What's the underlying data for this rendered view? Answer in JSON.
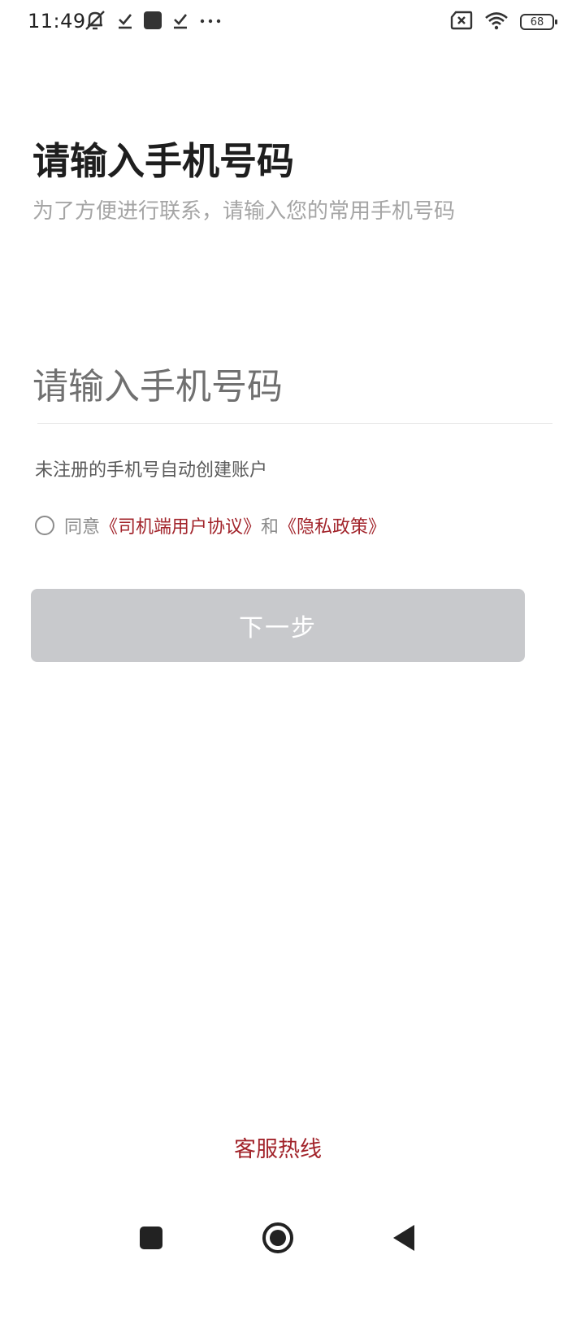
{
  "status_bar": {
    "time": "11:49",
    "battery_level": "68",
    "left_icons": [
      "bell-muted-icon",
      "download-done-icon",
      "app-square-icon",
      "download-done-icon",
      "more-dots-icon"
    ],
    "right_icons": [
      "no-sim-icon",
      "wifi-icon",
      "battery-icon"
    ]
  },
  "page": {
    "title": "请输入手机号码",
    "subtitle": "为了方便进行联系，请输入您的常用手机号码"
  },
  "phone_input": {
    "placeholder": "请输入手机号码",
    "value": ""
  },
  "hint": "未注册的手机号自动创建账户",
  "agreement": {
    "prefix": "同意",
    "user_agreement_label": "《司机端用户协议》",
    "conjunction": "和",
    "privacy_policy_label": "《隐私政策》",
    "checked": false
  },
  "next_button": {
    "label": "下一步",
    "enabled": false
  },
  "hotline_label": "客服热线",
  "colors": {
    "accent": "#a2242b",
    "button_disabled": "#c8c9cc",
    "title": "#1e1e1e",
    "subtitle": "#a5a5a5"
  },
  "nav_bar": {
    "icons": [
      "recents-square-icon",
      "home-circle-icon",
      "back-triangle-icon"
    ]
  }
}
